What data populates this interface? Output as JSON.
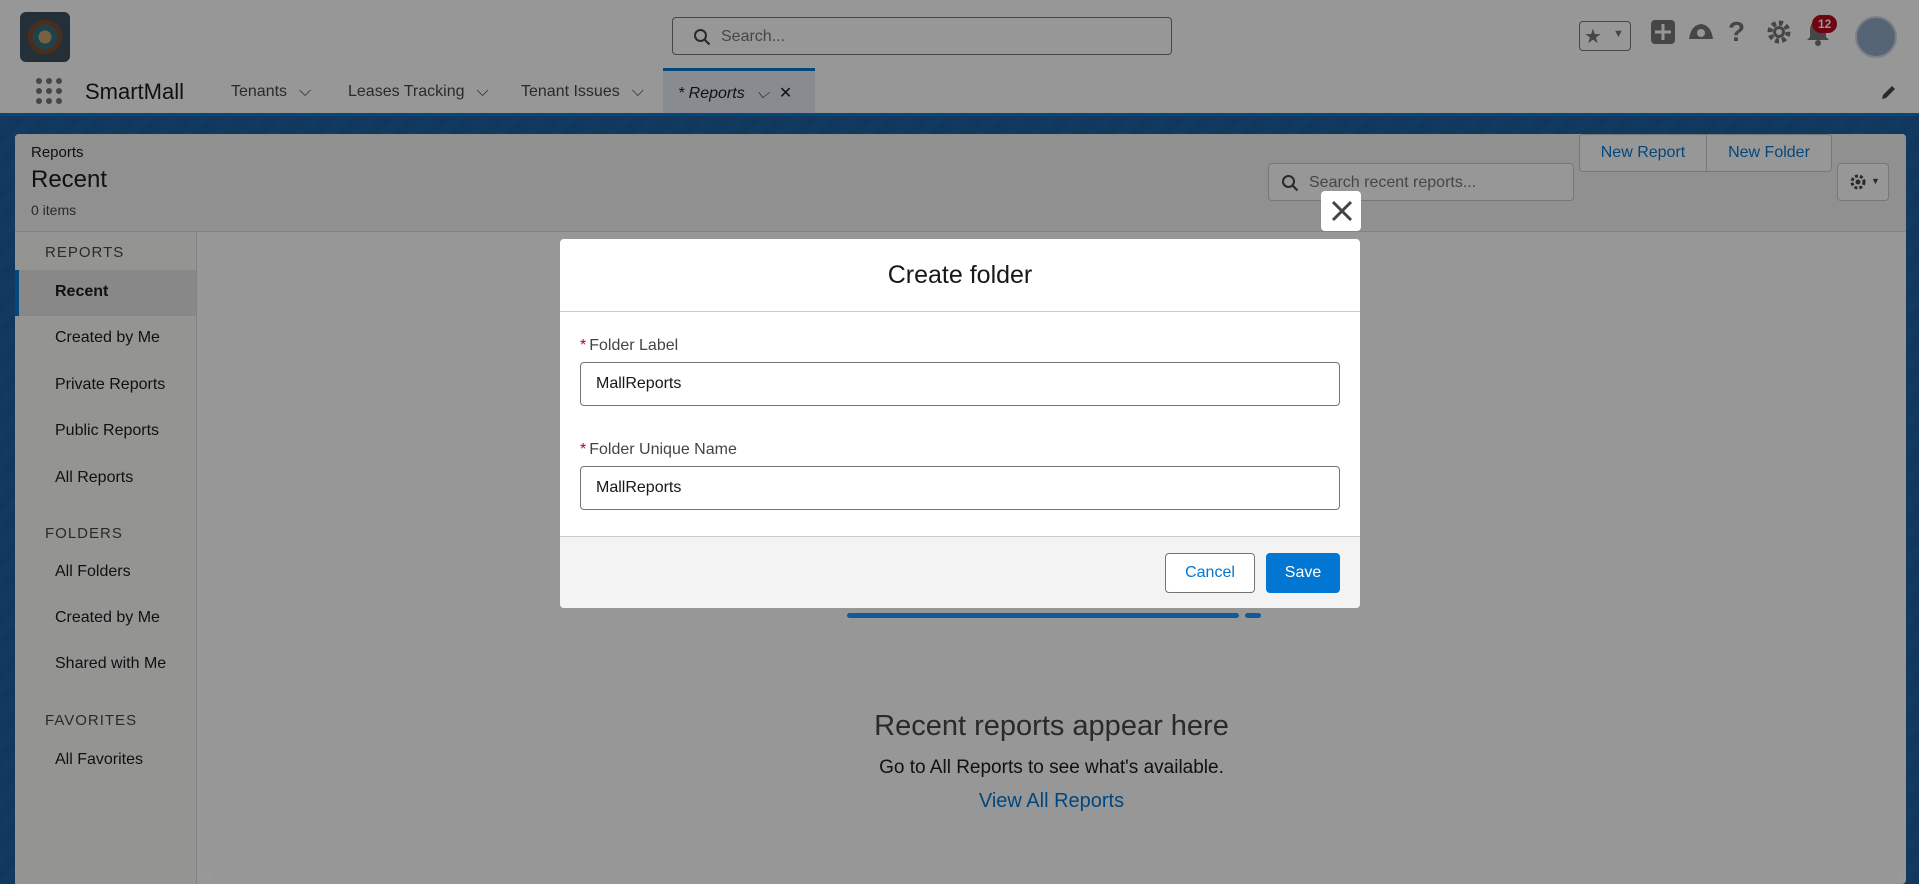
{
  "header": {
    "search_placeholder": "Search...",
    "notification_count": "12"
  },
  "nav": {
    "app_name": "SmartMall",
    "tabs": [
      {
        "label": "Tenants"
      },
      {
        "label": "Leases Tracking"
      },
      {
        "label": "Tenant Issues"
      },
      {
        "label": "* Reports"
      }
    ]
  },
  "page": {
    "eyebrow": "Reports",
    "title": "Recent",
    "count": "0 items",
    "search_placeholder": "Search recent reports...",
    "new_report": "New Report",
    "new_folder": "New Folder"
  },
  "sidebar": {
    "sections": [
      {
        "title": "REPORTS",
        "items": [
          "Recent",
          "Created by Me",
          "Private Reports",
          "Public Reports",
          "All Reports"
        ]
      },
      {
        "title": "FOLDERS",
        "items": [
          "All Folders",
          "Created by Me",
          "Shared with Me"
        ]
      },
      {
        "title": "FAVORITES",
        "items": [
          "All Favorites"
        ]
      }
    ]
  },
  "empty_state": {
    "title": "Recent reports appear here",
    "subtitle": "Go to All Reports to see what's available.",
    "link": "View All Reports"
  },
  "modal": {
    "title": "Create folder",
    "folder_label": {
      "label": "Folder Label",
      "value": "MallReports"
    },
    "folder_unique_name": {
      "label": "Folder Unique Name",
      "value": "MallReports"
    },
    "cancel": "Cancel",
    "save": "Save"
  },
  "colors": {
    "brand_blue": "#0176d3",
    "required_red": "#ba0517"
  }
}
